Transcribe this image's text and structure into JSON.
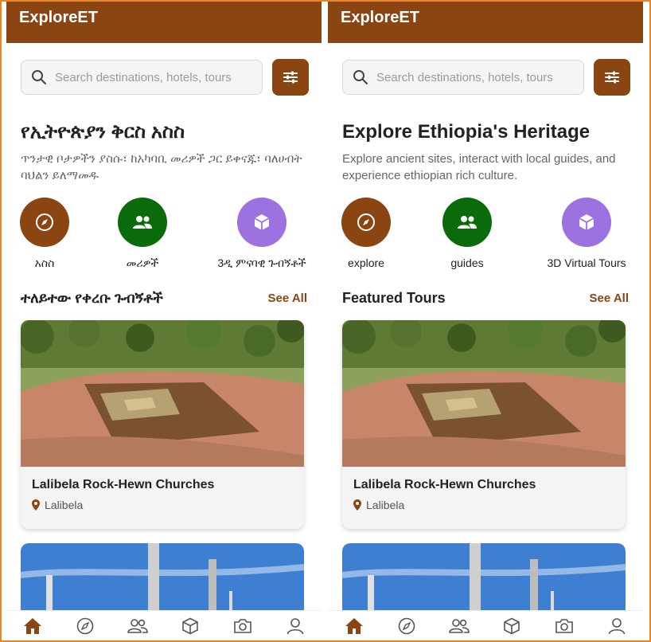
{
  "colors": {
    "brand": "#8b4513",
    "green": "#0a6b0a",
    "purple": "#9b72e0",
    "accent": "#e8862a"
  },
  "screens": [
    {
      "app_title": "ExploreET",
      "search_placeholder": "Search destinations, hotels, tours",
      "hero_title": "የኢትዮጵያን ቅርስ አስስ",
      "hero_subtitle": "ጥንታዊ ቦታዎችን ያስሱ፣ ከአካባቢ መሪዎች ጋር ይቀናጁ፣ ባለሀብት ባህልን ይለማመዱ",
      "categories": [
        {
          "label": "አስስ",
          "icon": "compass-icon"
        },
        {
          "label": "መሪዎች",
          "icon": "users-icon"
        },
        {
          "label": "3ዲ ምናባዊ ጉብኝቶች",
          "icon": "cube-icon"
        }
      ],
      "section_title": "ተለይተው የቀረቡ ጉብኝቶች",
      "see_all": "See All",
      "featured": {
        "title": "Lalibela Rock-Hewn Churches",
        "location": "Lalibela"
      }
    },
    {
      "app_title": "ExploreET",
      "search_placeholder": "Search destinations, hotels, tours",
      "hero_title": "Explore Ethiopia's Heritage",
      "hero_subtitle": "Explore ancient sites, interact with local guides, and experience ethiopian rich culture.",
      "categories": [
        {
          "label": "explore",
          "icon": "compass-icon"
        },
        {
          "label": "guides",
          "icon": "users-icon"
        },
        {
          "label": "3D Virtual Tours",
          "icon": "cube-icon"
        }
      ],
      "section_title": "Featured Tours",
      "see_all": "See All",
      "featured": {
        "title": "Lalibela Rock-Hewn Churches",
        "location": "Lalibela"
      }
    }
  ],
  "bottom_nav": [
    "home-icon",
    "compass-icon",
    "users-icon",
    "cube-icon",
    "camera-icon",
    "profile-icon"
  ]
}
